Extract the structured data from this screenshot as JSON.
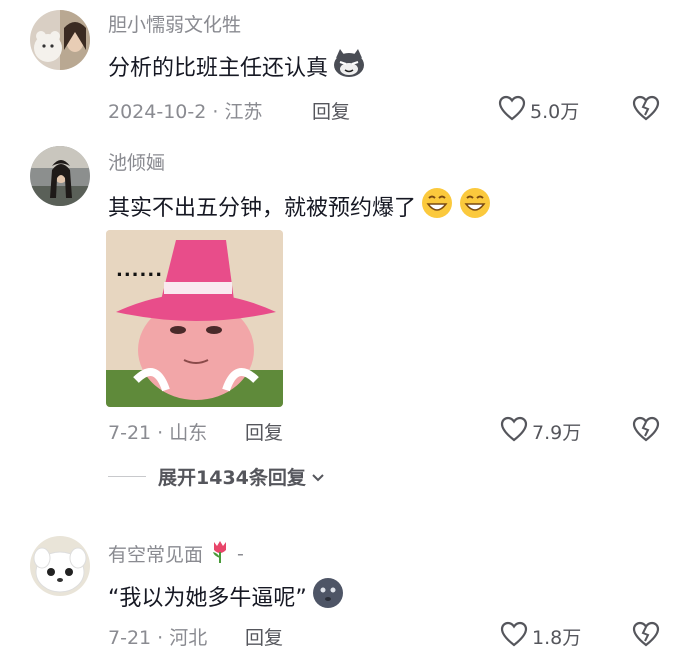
{
  "comments": [
    {
      "username": "胆小懦弱文化牲",
      "text": "分析的比班主任还认真",
      "date_location": "2024-10-2 · 江苏",
      "reply_label": "回复",
      "like_count": "5.0万"
    },
    {
      "username": "池倾婳",
      "text": "其实不出五分钟，就被预约爆了",
      "date_location": "7-21 · 山东",
      "reply_label": "回复",
      "like_count": "7.9万",
      "sticker_text": "......",
      "expand_label": "展开1434条回复"
    },
    {
      "username": "有空常见面",
      "username_suffix": "-",
      "text": "“我以为她多牛逼呢”",
      "date_location": "7-21 · 河北",
      "reply_label": "回复",
      "like_count": "1.8万"
    }
  ],
  "icons": {
    "like": "heart-outline-icon",
    "dislike": "broken-heart-icon",
    "expand": "chevron-down-icon"
  }
}
